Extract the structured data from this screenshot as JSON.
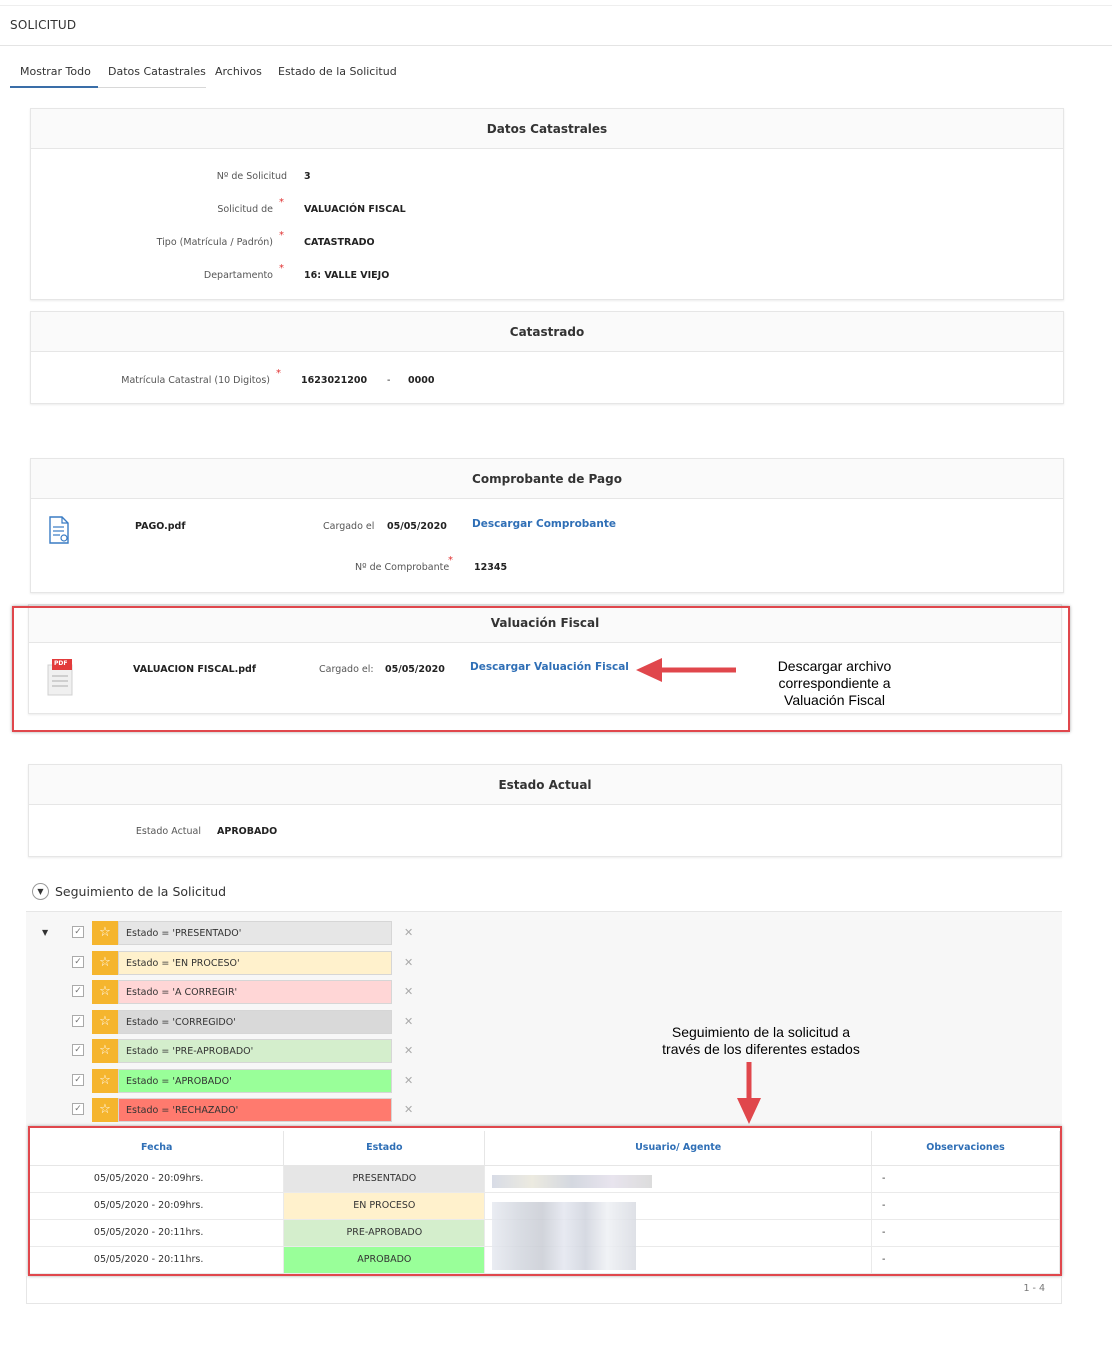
{
  "page": {
    "title": "SOLICITUD"
  },
  "tabs": [
    {
      "label": "Mostrar Todo"
    },
    {
      "label": "Datos Catastrales"
    },
    {
      "label": "Archivos"
    },
    {
      "label": "Estado de la Solicitud"
    }
  ],
  "datos_catastrales": {
    "title": "Datos Catastrales",
    "fields": [
      {
        "label": "Nº de Solicitud",
        "value": "3",
        "required": false
      },
      {
        "label": "Solicitud de",
        "value": "VALUACIÓN FISCAL",
        "required": true
      },
      {
        "label": "Tipo (Matrícula / Padrón)",
        "value": "CATASTRADO",
        "required": true
      },
      {
        "label": "Departamento",
        "value": "16: VALLE VIEJO",
        "required": true
      }
    ]
  },
  "catastrado": {
    "title": "Catastrado",
    "matricula_label": "Matrícula Catastral (10 Digitos)",
    "matricula_value": "1623021200",
    "separator": "-",
    "matricula_suffix": "0000"
  },
  "comprobante": {
    "title": "Comprobante de Pago",
    "file_name": "PAGO.pdf",
    "uploaded_label": "Cargado el",
    "uploaded_date": "05/05/2020",
    "download_label": "Descargar Comprobante",
    "numero_label": "Nº de Comprobante",
    "numero_value": "12345"
  },
  "valuacion": {
    "title": "Valuación Fiscal",
    "file_name": "VALUACION FISCAL.pdf",
    "uploaded_label": "Cargado el:",
    "uploaded_date": "05/05/2020",
    "download_label": "Descargar Valuación Fiscal",
    "pdf_badge": "PDF"
  },
  "annotations": {
    "download_line1": "Descargar archivo",
    "download_line2": "correspondiente a",
    "download_line3": "Valuación Fiscal",
    "tracking_line1": "Seguimiento de la solicitud a",
    "tracking_line2": "través de los diferentes estados"
  },
  "estado_actual": {
    "title": "Estado Actual",
    "label": "Estado Actual",
    "value": "APROBADO"
  },
  "seguimiento": {
    "title": "Seguimiento de la Solicitud",
    "filters": [
      {
        "label": "Estado = 'PRESENTADO'",
        "color": "#e6e6e6"
      },
      {
        "label": "Estado = 'EN PROCESO'",
        "color": "#fff1cc"
      },
      {
        "label": "Estado = 'A CORREGIR'",
        "color": "#ffd6d6"
      },
      {
        "label": "Estado = 'CORREGIDO'",
        "color": "#d9d9d9"
      },
      {
        "label": "Estado = 'PRE-APROBADO'",
        "color": "#d4eecc"
      },
      {
        "label": "Estado = 'APROBADO'",
        "color": "#99ff99"
      },
      {
        "label": "Estado = 'RECHAZADO'",
        "color": "#ff7a6e"
      }
    ],
    "columns": [
      "Fecha",
      "Estado",
      "Usuario/ Agente",
      "Observaciones"
    ],
    "rows": [
      {
        "fecha": "05/05/2020 - 20:09hrs.",
        "estado": "PRESENTADO",
        "color": "#e6e6e6",
        "obs": "-"
      },
      {
        "fecha": "05/05/2020 - 20:09hrs.",
        "estado": "EN PROCESO",
        "color": "#fff1cc",
        "obs": "-"
      },
      {
        "fecha": "05/05/2020 - 20:11hrs.",
        "estado": "PRE-APROBADO",
        "color": "#d4eecc",
        "obs": "-"
      },
      {
        "fecha": "05/05/2020 - 20:11hrs.",
        "estado": "APROBADO",
        "color": "#99ff99",
        "obs": "-"
      }
    ],
    "pagination": "1 - 4"
  },
  "colors": {
    "accent": "#2f6fb6",
    "annotation_red": "#e0474c",
    "star": "#f5b52e"
  }
}
